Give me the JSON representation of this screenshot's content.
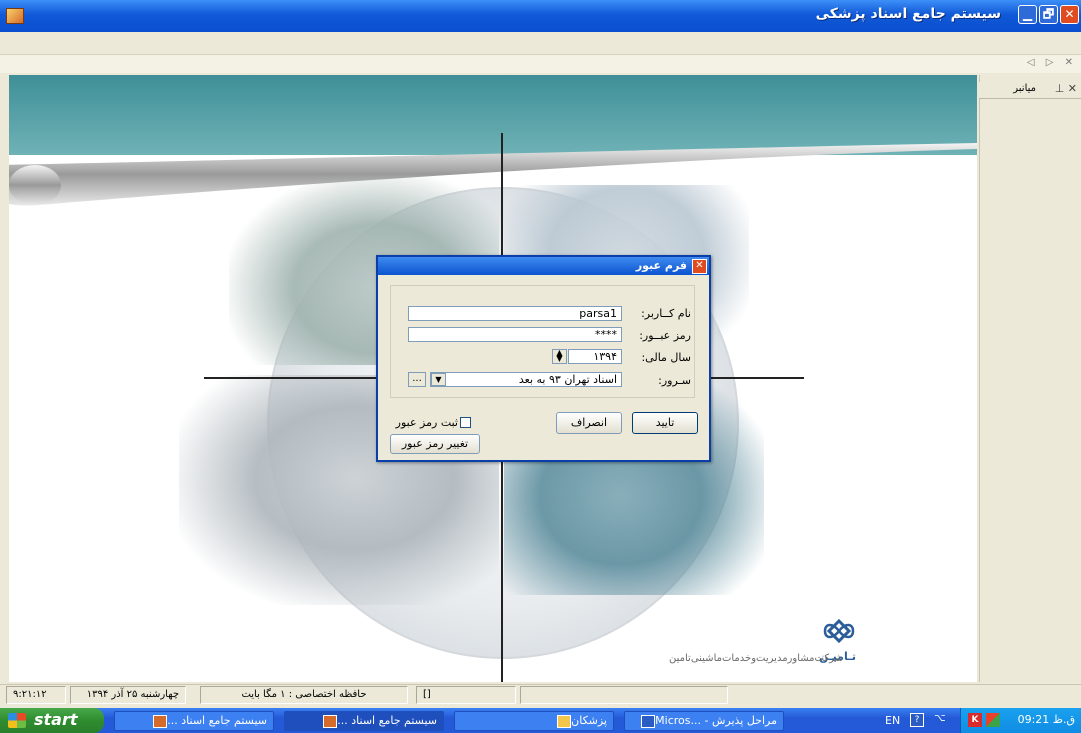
{
  "window": {
    "title": "سیستم جامع اسناد پزشکی",
    "close": "✕",
    "restore": "🗗",
    "minimize": "▁"
  },
  "tab_nav": "◁ ▷ ✕",
  "panel": {
    "title": "میانبر",
    "controls": "⊥ ✕"
  },
  "branding": {
    "logo_text": "تـامیـن",
    "company": "شرکت‌مشاورمدیریت‌وخدمات‌ماشینی‌تامین"
  },
  "dialog": {
    "title": "فرم عبور",
    "username_label": "نام کــاربر:",
    "username_value": "parsa1",
    "password_label": "رمز عبــور:",
    "password_value": "****",
    "year_label": "سال  مالی:",
    "year_value": "۱۳۹۴",
    "server_label": "سـرور:",
    "server_value": "اسناد تهران ۹۳ به بعد",
    "browse": "...",
    "ok": "تایید",
    "cancel": "انصراف",
    "save_password": "ثبت رمز عبور",
    "change_password": "تغییر رمز عبور"
  },
  "statusbar": {
    "time": "۹:۲۱:۱۲",
    "date": "چهارشنبه ۲۵ آذر ۱۳۹۴",
    "memory": "حافظه اختصاصی : ۱ مگا بایت",
    "bracket": "[]"
  },
  "taskbar": {
    "start": "start",
    "tasks": [
      "... سیستم جامع اسناد",
      "... سیستم جامع اسناد",
      "پزشکان",
      "Micros... - مراحل پذیرش"
    ],
    "lang": "EN",
    "clock": "ق.ظ 09:21"
  },
  "colors": {
    "titlebar": "#0a4fcf",
    "taskbar": "#245ad9",
    "start": "#2f8c30",
    "teal_header": "#3f8f98",
    "close": "#e04b1f"
  }
}
